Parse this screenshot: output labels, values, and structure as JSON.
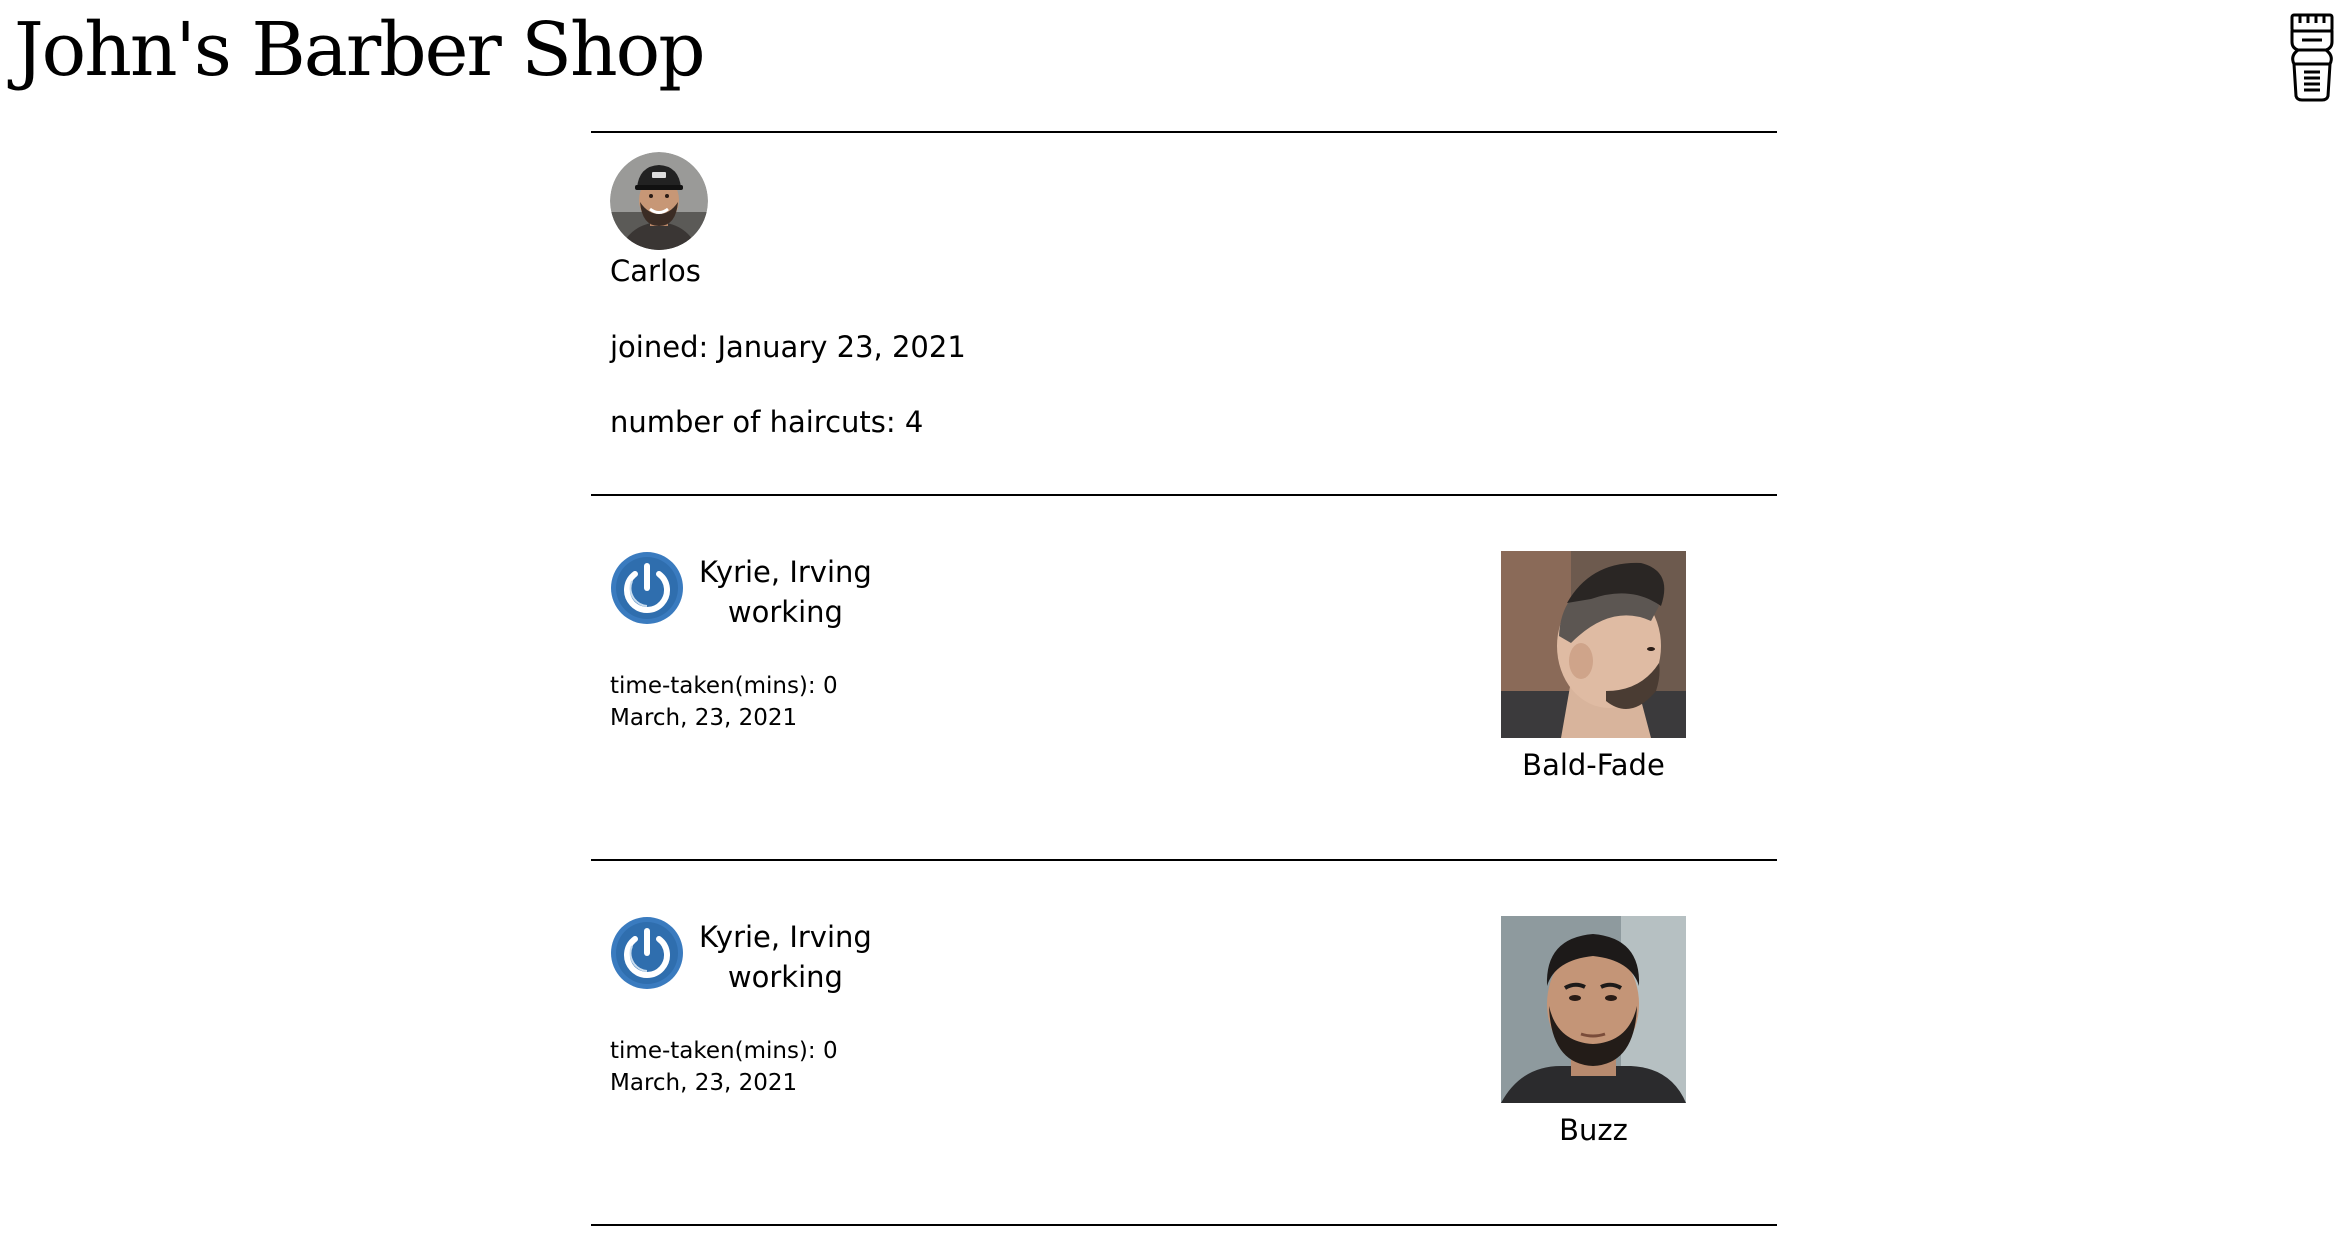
{
  "header": {
    "title": "John's Barber Shop",
    "logo_icon": "hair-clipper-icon"
  },
  "profile": {
    "name": "Carlos",
    "joined": "joined: January 23, 2021",
    "haircuts": "number of haircuts: 4",
    "avatar_icon": "customer-avatar"
  },
  "appointments": [
    {
      "barber_name": "Kyrie, Irving",
      "status": "working",
      "time_taken": "time-taken(mins): 0",
      "date": "March, 23, 2021",
      "haircut_style": "Bald-Fade",
      "status_icon": "power-icon"
    },
    {
      "barber_name": "Kyrie, Irving",
      "status": "working",
      "time_taken": "time-taken(mins): 0",
      "date": "March, 23, 2021",
      "haircut_style": "Buzz",
      "status_icon": "power-icon"
    }
  ],
  "colors": {
    "accent_blue": "#3a7bbf",
    "text": "#000000",
    "background": "#ffffff"
  }
}
